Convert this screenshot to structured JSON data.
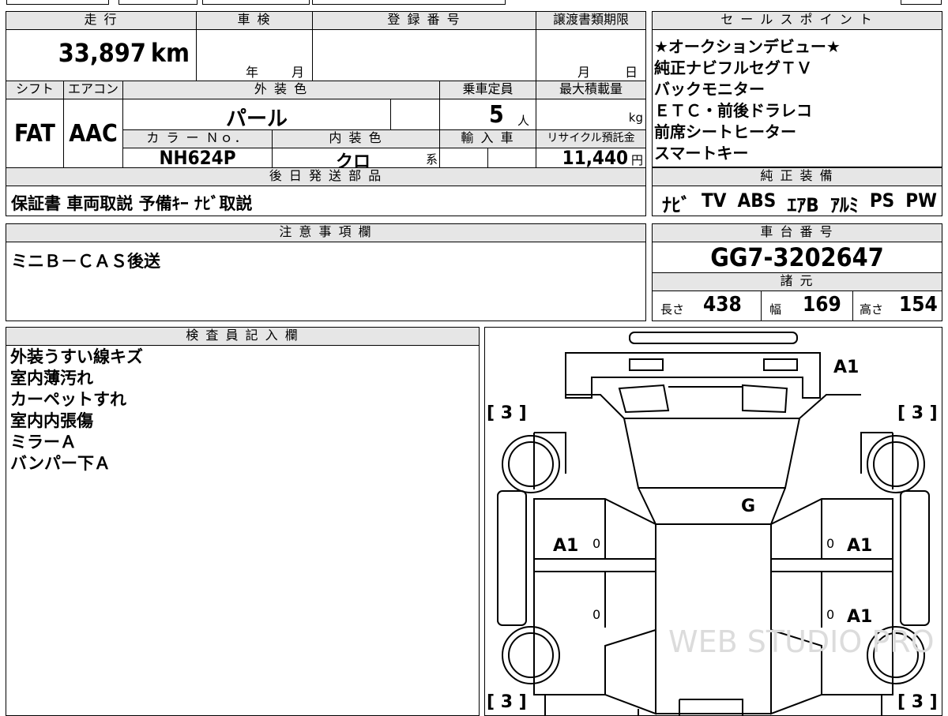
{
  "top_strip": {
    "fragment": "登録番号"
  },
  "mileage": {
    "header": "走 行",
    "value": "33,897",
    "unit": "km"
  },
  "inspection": {
    "header": "車 検",
    "year_label": "年",
    "month_label": "月"
  },
  "registration": {
    "header": "登 録 番 号",
    "value": ""
  },
  "transfer_deadline": {
    "header": "譲渡書類期限",
    "month_label": "月",
    "day_label": "日"
  },
  "sales_points": {
    "header": "セ ー ル ス ポ イ ン ト",
    "items": [
      "★オークションデビュー★",
      "純正ナビフルセグＴＶ",
      "バックモニター",
      "ＥＴＣ・前後ドラレコ",
      "前席シートヒーター",
      "スマートキー"
    ]
  },
  "shift": {
    "header": "シフト",
    "value": "FAT"
  },
  "aircon": {
    "header": "エアコン",
    "value": "AAC"
  },
  "exterior_color": {
    "header": "外 装 色",
    "value": "パール"
  },
  "capacity": {
    "header": "乗車定員",
    "value": "5",
    "unit": "人"
  },
  "max_load": {
    "header": "最大積載量",
    "value": "",
    "unit": "kg"
  },
  "color_no": {
    "header": "カ ラ ー Ｎｏ．",
    "value": "NH624P"
  },
  "interior_color": {
    "header": "内 装 色",
    "value": "クロ",
    "suffix": "系"
  },
  "import": {
    "header": "輸 入 車",
    "value": ""
  },
  "recycle": {
    "header": "リサイクル預託金",
    "value": "11,440",
    "unit": "円"
  },
  "later_parts": {
    "header": "後 日 発 送 部 品",
    "value": "保証書 車両取説 予備ｷｰ ﾅﾋﾞ取説"
  },
  "genuine_equipment": {
    "header": "純 正 装 備",
    "items": [
      "ﾅﾋﾞ",
      "TV",
      "ABS",
      "ｴｱB",
      "ｱﾙﾐ",
      "PS",
      "PW"
    ]
  },
  "notes": {
    "header": "注 意 事 項 欄",
    "value": "ミニＢ－ＣＡＳ後送"
  },
  "chassis_no": {
    "header": "車 台 番 号",
    "value": "GG7-3202647"
  },
  "specs": {
    "header": "諸 元",
    "length_label": "長さ",
    "length": "438",
    "width_label": "幅",
    "width": "169",
    "height_label": "高さ",
    "height": "154"
  },
  "inspector": {
    "header": "検 査 員 記 入 欄",
    "items": [
      "外装うすい線キズ",
      "室内薄汚れ",
      "カーペットすれ",
      "室内内張傷",
      "ミラーＡ",
      "バンパー下Ａ"
    ]
  },
  "diagram": {
    "marks": {
      "roof_front": "A1",
      "windshield": "G",
      "left_front_door": "A1",
      "right_front_door": "A1",
      "right_rear_door": "A1",
      "left_front_door_sub": "0",
      "right_front_door_sub": "0",
      "left_rear_door_sub": "0",
      "right_rear_door_sub": "0",
      "tire_front_left": "[ 3 ]",
      "tire_front_right": "[ 3 ]",
      "tire_rear_left": "[ 3 ]",
      "tire_rear_right": "[ 3 ]"
    },
    "watermark": "WEB STUDIO PRO"
  }
}
